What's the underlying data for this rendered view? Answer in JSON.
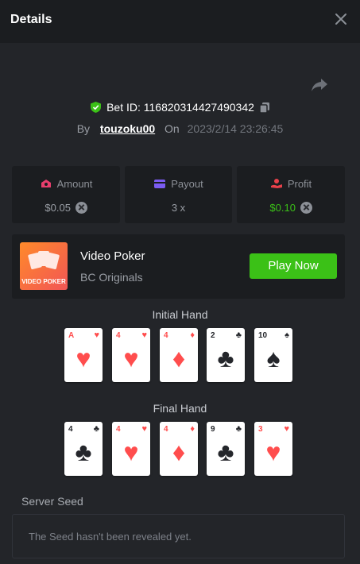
{
  "header": {
    "title": "Details",
    "close_icon": "close-icon"
  },
  "bet": {
    "label": "Bet ID: 116820314427490342",
    "by_label": "By",
    "user": "touzoku00",
    "on_label": "On",
    "date": "2023/2/14 23:26:45"
  },
  "stats": {
    "amount": {
      "label": "Amount",
      "value": "$0.05"
    },
    "payout": {
      "label": "Payout",
      "value": "3 x"
    },
    "profit": {
      "label": "Profit",
      "value": "$0.10"
    }
  },
  "game": {
    "name": "Video Poker",
    "provider": "BC Originals",
    "thumb_text": "VIDEO POKER",
    "play_label": "Play Now"
  },
  "initial_hand": {
    "title": "Initial Hand",
    "cards": [
      {
        "rank": "A",
        "suit": "♥",
        "color": "red"
      },
      {
        "rank": "4",
        "suit": "♥",
        "color": "red"
      },
      {
        "rank": "4",
        "suit": "♦",
        "color": "red"
      },
      {
        "rank": "2",
        "suit": "♣",
        "color": "black"
      },
      {
        "rank": "10",
        "suit": "♠",
        "color": "black"
      }
    ]
  },
  "final_hand": {
    "title": "Final Hand",
    "cards": [
      {
        "rank": "4",
        "suit": "♣",
        "color": "black"
      },
      {
        "rank": "4",
        "suit": "♥",
        "color": "red"
      },
      {
        "rank": "4",
        "suit": "♦",
        "color": "red"
      },
      {
        "rank": "9",
        "suit": "♣",
        "color": "black"
      },
      {
        "rank": "3",
        "suit": "♥",
        "color": "red"
      }
    ]
  },
  "seed": {
    "label": "Server Seed",
    "message": "The Seed hasn't been revealed yet."
  },
  "colors": {
    "accent_green": "#3bc117",
    "background": "#232529",
    "panel": "#1b1d20"
  }
}
